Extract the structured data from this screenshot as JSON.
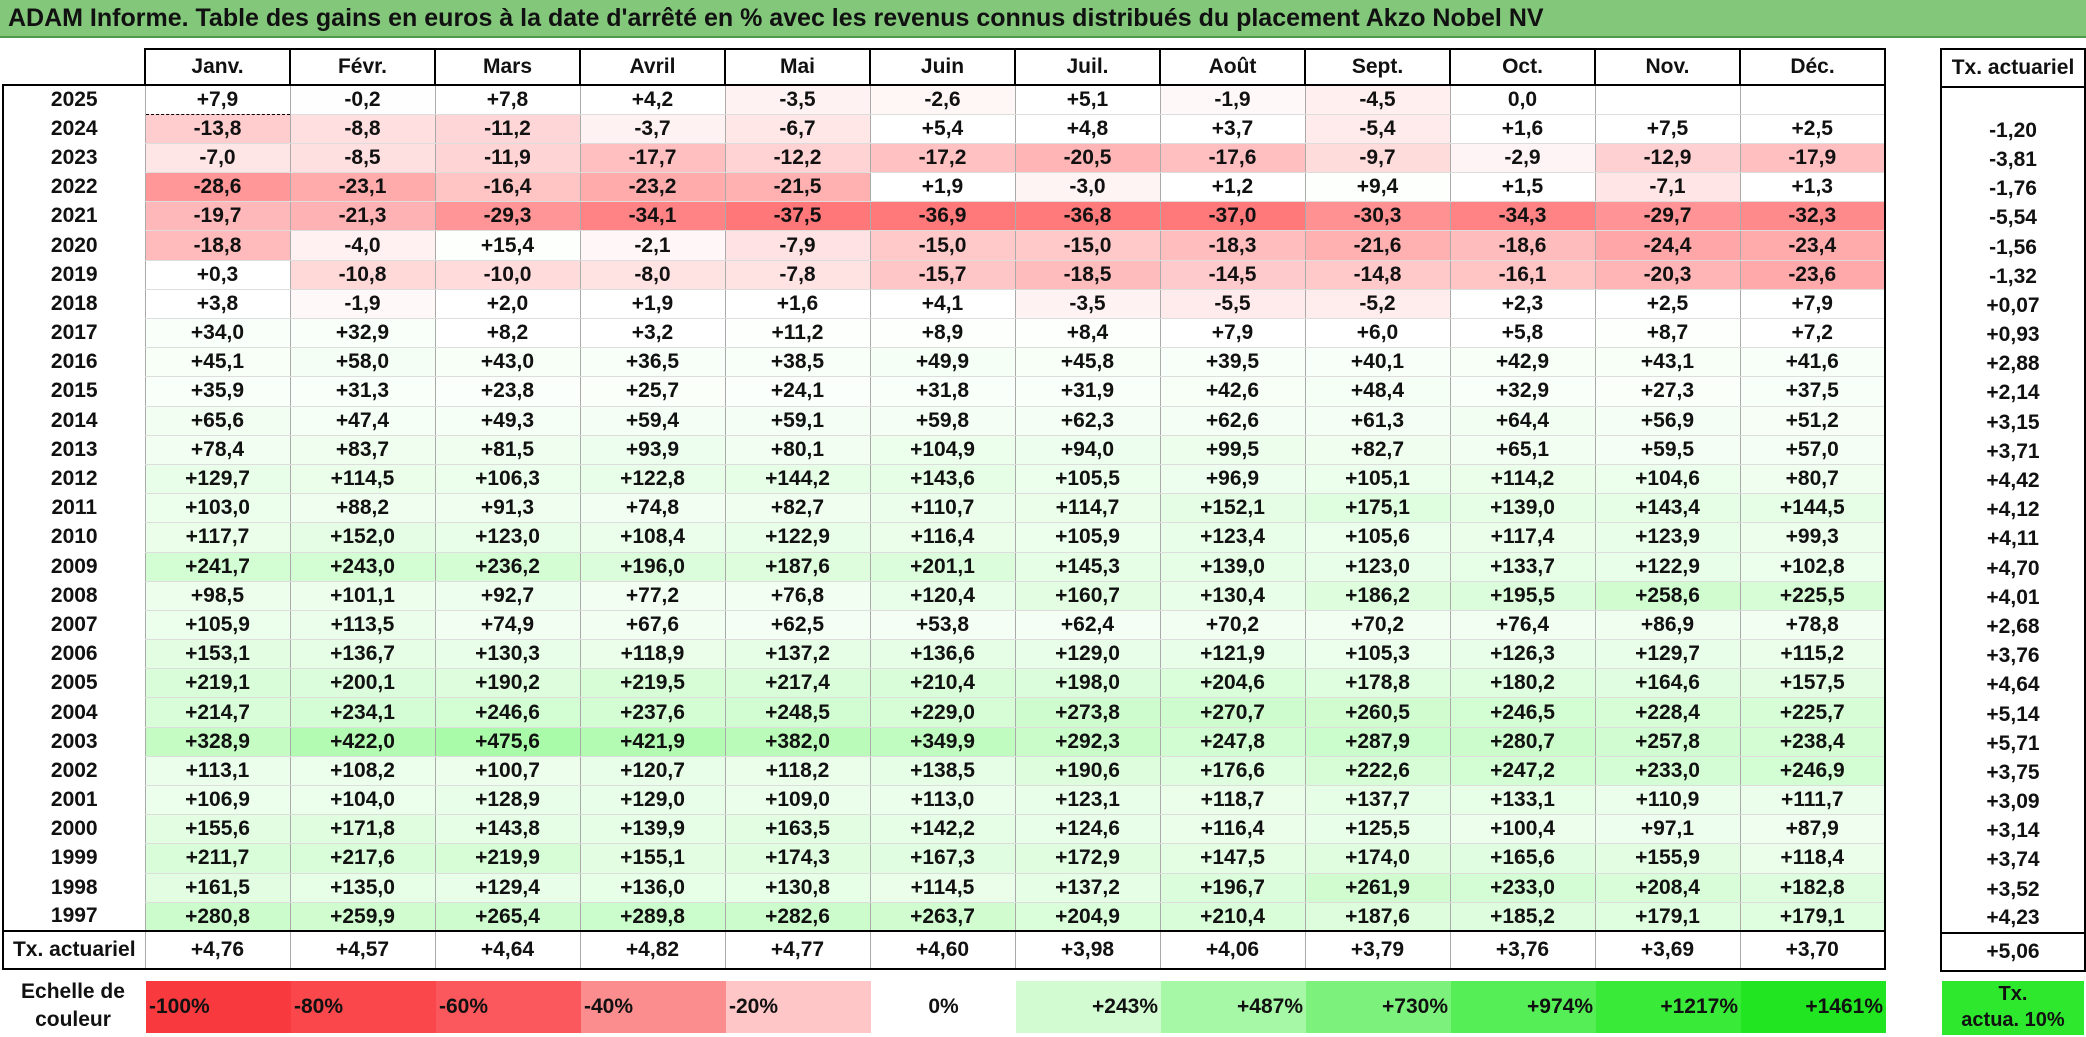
{
  "title": "ADAM Informe. Table des gains en euros à la date d'arrêté en % avec les revenus connus distribués du placement Akzo Nobel NV",
  "months": [
    "Janv.",
    "Févr.",
    "Mars",
    "Avril",
    "Mai",
    "Juin",
    "Juil.",
    "Août",
    "Sept.",
    "Oct.",
    "Nov.",
    "Déc."
  ],
  "rate_header": "Tx. actuariel",
  "rows": [
    {
      "year": "2025",
      "values": [
        "+7,9",
        "-0,2",
        "+7,8",
        "+4,2",
        "-3,5",
        "-2,6",
        "+5,1",
        "-1,9",
        "-4,5",
        "0,0",
        "",
        ""
      ],
      "rate": ""
    },
    {
      "year": "2024",
      "values": [
        "-13,8",
        "-8,8",
        "-11,2",
        "-3,7",
        "-6,7",
        "+5,4",
        "+4,8",
        "+3,7",
        "-5,4",
        "+1,6",
        "+7,5",
        "+2,5"
      ],
      "rate": "-1,20"
    },
    {
      "year": "2023",
      "values": [
        "-7,0",
        "-8,5",
        "-11,9",
        "-17,7",
        "-12,2",
        "-17,2",
        "-20,5",
        "-17,6",
        "-9,7",
        "-2,9",
        "-12,9",
        "-17,9"
      ],
      "rate": "-3,81"
    },
    {
      "year": "2022",
      "values": [
        "-28,6",
        "-23,1",
        "-16,4",
        "-23,2",
        "-21,5",
        "+1,9",
        "-3,0",
        "+1,2",
        "+9,4",
        "+1,5",
        "-7,1",
        "+1,3"
      ],
      "rate": "-1,76"
    },
    {
      "year": "2021",
      "values": [
        "-19,7",
        "-21,3",
        "-29,3",
        "-34,1",
        "-37,5",
        "-36,9",
        "-36,8",
        "-37,0",
        "-30,3",
        "-34,3",
        "-29,7",
        "-32,3"
      ],
      "rate": "-5,54"
    },
    {
      "year": "2020",
      "values": [
        "-18,8",
        "-4,0",
        "+15,4",
        "-2,1",
        "-7,9",
        "-15,0",
        "-15,0",
        "-18,3",
        "-21,6",
        "-18,6",
        "-24,4",
        "-23,4"
      ],
      "rate": "-1,56"
    },
    {
      "year": "2019",
      "values": [
        "+0,3",
        "-10,8",
        "-10,0",
        "-8,0",
        "-7,8",
        "-15,7",
        "-18,5",
        "-14,5",
        "-14,8",
        "-16,1",
        "-20,3",
        "-23,6"
      ],
      "rate": "-1,32"
    },
    {
      "year": "2018",
      "values": [
        "+3,8",
        "-1,9",
        "+2,0",
        "+1,9",
        "+1,6",
        "+4,1",
        "-3,5",
        "-5,5",
        "-5,2",
        "+2,3",
        "+2,5",
        "+7,9"
      ],
      "rate": "+0,07"
    },
    {
      "year": "2017",
      "values": [
        "+34,0",
        "+32,9",
        "+8,2",
        "+3,2",
        "+11,2",
        "+8,9",
        "+8,4",
        "+7,9",
        "+6,0",
        "+5,8",
        "+8,7",
        "+7,2"
      ],
      "rate": "+0,93"
    },
    {
      "year": "2016",
      "values": [
        "+45,1",
        "+58,0",
        "+43,0",
        "+36,5",
        "+38,5",
        "+49,9",
        "+45,8",
        "+39,5",
        "+40,1",
        "+42,9",
        "+43,1",
        "+41,6"
      ],
      "rate": "+2,88"
    },
    {
      "year": "2015",
      "values": [
        "+35,9",
        "+31,3",
        "+23,8",
        "+25,7",
        "+24,1",
        "+31,8",
        "+31,9",
        "+42,6",
        "+48,4",
        "+32,9",
        "+27,3",
        "+37,5"
      ],
      "rate": "+2,14"
    },
    {
      "year": "2014",
      "values": [
        "+65,6",
        "+47,4",
        "+49,3",
        "+59,4",
        "+59,1",
        "+59,8",
        "+62,3",
        "+62,6",
        "+61,3",
        "+64,4",
        "+56,9",
        "+51,2"
      ],
      "rate": "+3,15"
    },
    {
      "year": "2013",
      "values": [
        "+78,4",
        "+83,7",
        "+81,5",
        "+93,9",
        "+80,1",
        "+104,9",
        "+94,0",
        "+99,5",
        "+82,7",
        "+65,1",
        "+59,5",
        "+57,0"
      ],
      "rate": "+3,71"
    },
    {
      "year": "2012",
      "values": [
        "+129,7",
        "+114,5",
        "+106,3",
        "+122,8",
        "+144,2",
        "+143,6",
        "+105,5",
        "+96,9",
        "+105,1",
        "+114,2",
        "+104,6",
        "+80,7"
      ],
      "rate": "+4,42"
    },
    {
      "year": "2011",
      "values": [
        "+103,0",
        "+88,2",
        "+91,3",
        "+74,8",
        "+82,7",
        "+110,7",
        "+114,7",
        "+152,1",
        "+175,1",
        "+139,0",
        "+143,4",
        "+144,5"
      ],
      "rate": "+4,12"
    },
    {
      "year": "2010",
      "values": [
        "+117,7",
        "+152,0",
        "+123,0",
        "+108,4",
        "+122,9",
        "+116,4",
        "+105,9",
        "+123,4",
        "+105,6",
        "+117,4",
        "+123,9",
        "+99,3"
      ],
      "rate": "+4,11"
    },
    {
      "year": "2009",
      "values": [
        "+241,7",
        "+243,0",
        "+236,2",
        "+196,0",
        "+187,6",
        "+201,1",
        "+145,3",
        "+139,0",
        "+123,0",
        "+133,7",
        "+122,9",
        "+102,8"
      ],
      "rate": "+4,70"
    },
    {
      "year": "2008",
      "values": [
        "+98,5",
        "+101,1",
        "+92,7",
        "+77,2",
        "+76,8",
        "+120,4",
        "+160,7",
        "+130,4",
        "+186,2",
        "+195,5",
        "+258,6",
        "+225,5"
      ],
      "rate": "+4,01"
    },
    {
      "year": "2007",
      "values": [
        "+105,9",
        "+113,5",
        "+74,9",
        "+67,6",
        "+62,5",
        "+53,8",
        "+62,4",
        "+70,2",
        "+70,2",
        "+76,4",
        "+86,9",
        "+78,8"
      ],
      "rate": "+2,68"
    },
    {
      "year": "2006",
      "values": [
        "+153,1",
        "+136,7",
        "+130,3",
        "+118,9",
        "+137,2",
        "+136,6",
        "+129,0",
        "+121,9",
        "+105,3",
        "+126,3",
        "+129,7",
        "+115,2"
      ],
      "rate": "+3,76"
    },
    {
      "year": "2005",
      "values": [
        "+219,1",
        "+200,1",
        "+190,2",
        "+219,5",
        "+217,4",
        "+210,4",
        "+198,0",
        "+204,6",
        "+178,8",
        "+180,2",
        "+164,6",
        "+157,5"
      ],
      "rate": "+4,64"
    },
    {
      "year": "2004",
      "values": [
        "+214,7",
        "+234,1",
        "+246,6",
        "+237,6",
        "+248,5",
        "+229,0",
        "+273,8",
        "+270,7",
        "+260,5",
        "+246,5",
        "+228,4",
        "+225,7"
      ],
      "rate": "+5,14"
    },
    {
      "year": "2003",
      "values": [
        "+328,9",
        "+422,0",
        "+475,6",
        "+421,9",
        "+382,0",
        "+349,9",
        "+292,3",
        "+247,8",
        "+287,9",
        "+280,7",
        "+257,8",
        "+238,4"
      ],
      "rate": "+5,71"
    },
    {
      "year": "2002",
      "values": [
        "+113,1",
        "+108,2",
        "+100,7",
        "+120,7",
        "+118,2",
        "+138,5",
        "+190,6",
        "+176,6",
        "+222,6",
        "+247,2",
        "+233,0",
        "+246,9"
      ],
      "rate": "+3,75"
    },
    {
      "year": "2001",
      "values": [
        "+106,9",
        "+104,0",
        "+128,9",
        "+129,0",
        "+109,0",
        "+113,0",
        "+123,1",
        "+118,7",
        "+137,7",
        "+133,1",
        "+110,9",
        "+111,7"
      ],
      "rate": "+3,09"
    },
    {
      "year": "2000",
      "values": [
        "+155,6",
        "+171,8",
        "+143,8",
        "+139,9",
        "+163,5",
        "+142,2",
        "+124,6",
        "+116,4",
        "+125,5",
        "+100,4",
        "+97,1",
        "+87,9"
      ],
      "rate": "+3,14"
    },
    {
      "year": "1999",
      "values": [
        "+211,7",
        "+217,6",
        "+219,9",
        "+155,1",
        "+174,3",
        "+167,3",
        "+172,9",
        "+147,5",
        "+174,0",
        "+165,6",
        "+155,9",
        "+118,4"
      ],
      "rate": "+3,74"
    },
    {
      "year": "1998",
      "values": [
        "+161,5",
        "+135,0",
        "+129,4",
        "+136,0",
        "+130,8",
        "+114,5",
        "+137,2",
        "+196,7",
        "+261,9",
        "+233,0",
        "+208,4",
        "+182,8"
      ],
      "rate": "+3,52"
    },
    {
      "year": "1997",
      "values": [
        "+280,8",
        "+259,9",
        "+265,4",
        "+289,8",
        "+282,6",
        "+263,7",
        "+204,9",
        "+210,4",
        "+187,6",
        "+185,2",
        "+179,1",
        "+179,1"
      ],
      "rate": "+4,23"
    }
  ],
  "footer": {
    "label": "Tx. actuariel",
    "values": [
      "+4,76",
      "+4,57",
      "+4,64",
      "+4,82",
      "+4,77",
      "+4,60",
      "+3,98",
      "+4,06",
      "+3,79",
      "+3,76",
      "+3,69",
      "+3,70"
    ],
    "rate": "+5,06"
  },
  "scale": {
    "label_line1": "Echelle de",
    "label_line2": "couleur",
    "items": [
      {
        "label": "-100%",
        "color": "#f8393d"
      },
      {
        "label": "-80%",
        "color": "#f9474b"
      },
      {
        "label": "-60%",
        "color": "#fa585c"
      },
      {
        "label": "-40%",
        "color": "#fc8d8f"
      },
      {
        "label": "-20%",
        "color": "#fec6c7"
      },
      {
        "label": "0%",
        "color": "#ffffff"
      },
      {
        "label": "+243%",
        "color": "#d2fbd2"
      },
      {
        "label": "+487%",
        "color": "#a6f7a6"
      },
      {
        "label": "+730%",
        "color": "#7cf27c"
      },
      {
        "label": "+974%",
        "color": "#56ee56"
      },
      {
        "label": "+1217%",
        "color": "#39ea39"
      },
      {
        "label": "+1461%",
        "color": "#22e522"
      }
    ],
    "rate_line1": "Tx.",
    "rate_line2": "actua. 10%",
    "rate_color": "#2ee82e"
  }
}
